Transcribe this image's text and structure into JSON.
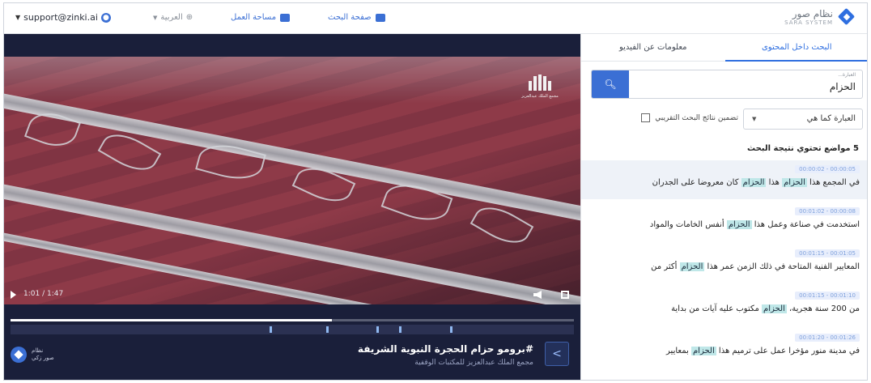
{
  "topbar": {
    "user_email": "support@zinki.ai",
    "language": "العربية",
    "workspace_link": "مساحة العمل",
    "search_page_link": "صفحة البحث",
    "logo_ar": "نظام صور",
    "logo_en": "SARA SYSTEM"
  },
  "video": {
    "time": "1:01 / 1:47",
    "progress_fraction": 0.57,
    "title": "#برومو حزام الحجرة النبوية الشريفة",
    "subtitle": "مجمع الملك عبدالعزيز للمكتبات الوقفية",
    "brand_line1": "نظام",
    "brand_line2": "صور زكي",
    "watermark": "مجمع الملك عبدالعزيز",
    "markers": [
      0.46,
      0.56,
      0.65,
      0.69,
      0.78
    ]
  },
  "panel": {
    "tab_search": "البحث داخل المحتوى",
    "tab_info": "معلومات عن الفيديو",
    "search_float_label": "العبارة...",
    "search_value": "الحزام",
    "match_mode": "العبارة كما هي",
    "approx_label": "تضمين نتائج البحث التقريبي",
    "results_count": "5 مواضع تحتوي نتيجة البحث",
    "results": [
      {
        "time": "00:00:02 - 00:00:05",
        "before": "في المجمع هذا ",
        "mid1": "الحزام",
        "middle": " هذا ",
        "mid2": "الحزام",
        "after": " كان معروضا على الجدران"
      },
      {
        "time": "00:01:02 - 00:00:08",
        "before": "استخدمت في صناعة وعمل هذا ",
        "mid1": "الحزام",
        "middle": "",
        "mid2": "",
        "after": " أنفس الخامات والمواد"
      },
      {
        "time": "00:01:15 - 00:01:05",
        "before": "المعايير الفنية المتاحة في ذلك الزمن عمر هذا ",
        "mid1": "الحزام",
        "middle": "",
        "mid2": "",
        "after": " أكثر من"
      },
      {
        "time": "00:01:15 - 00:01:10",
        "before": "من 200 سنة هجرية، ",
        "mid1": "الحزام",
        "middle": "",
        "mid2": "",
        "after": " مكتوب عليه آيات من بداية"
      },
      {
        "time": "00:01:20 - 00:01:26",
        "before": "في مدينة منور مؤخرا عمل على ترميم هذا ",
        "mid1": "الحزام",
        "middle": "",
        "mid2": "",
        "after": " بمعايير"
      }
    ]
  }
}
